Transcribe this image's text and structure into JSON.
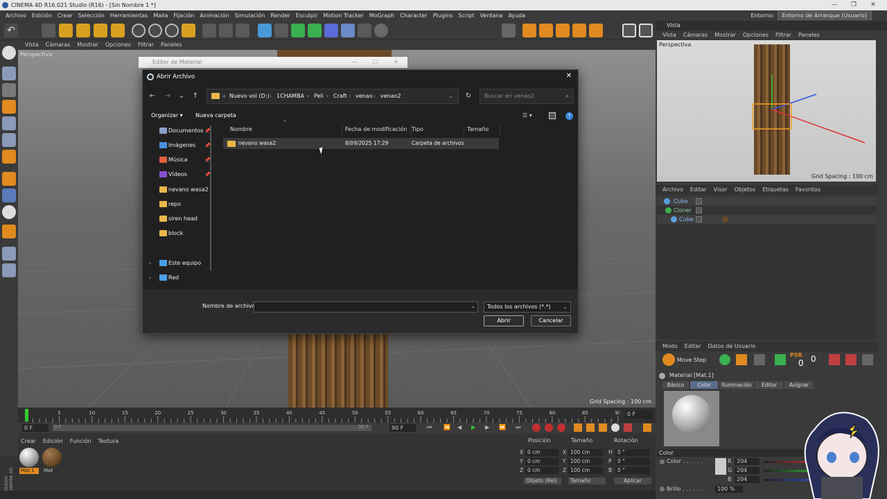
{
  "window": {
    "title": "CINEMA 4D R16.021 Studio (R16) - [Sin Nombre 1 *]",
    "controls": [
      "—",
      "❐",
      "✕"
    ]
  },
  "menubar": {
    "items": [
      "Archivo",
      "Edición",
      "Crear",
      "Selección",
      "Herramientas",
      "Malla",
      "Fijación",
      "Animación",
      "Simulación",
      "Render",
      "Esculpir",
      "Motion Tracker",
      "MoGraph",
      "Character",
      "Plugins",
      "Script",
      "Ventana",
      "Ayuda"
    ],
    "entorno_label": "Entorno:",
    "entorno_value": "Entorno de Arranque (Usuario)"
  },
  "viewport": {
    "menu": [
      "Vista",
      "Cámaras",
      "Mostrar",
      "Opciones",
      "Filtrar",
      "Paneles"
    ],
    "label": "Perspectiva",
    "grid_spacing": "Grid Spacing : 100 cm"
  },
  "right_view": {
    "header": "Vista",
    "menu": [
      "Vista",
      "Cámaras",
      "Mostrar",
      "Opciones",
      "Filtrar",
      "Paneles"
    ],
    "label": "Perspectiva",
    "grid_spacing": "Grid Spacing : 100 cm"
  },
  "object_manager": {
    "menu": [
      "Archivo",
      "Editar",
      "Visor",
      "Objetos",
      "Etiquetas",
      "Favoritos"
    ],
    "rows": [
      {
        "name": "Cube"
      },
      {
        "name": "Cloner"
      },
      {
        "name": "Cube"
      }
    ]
  },
  "attributes": {
    "menu": [
      "Modo",
      "Editar",
      "Datos de Usuario"
    ],
    "move_step": "Move Step",
    "psr": "PSR",
    "psr_val": "0",
    "l_val": "0",
    "material_name": "Material [Mat.1]",
    "tabs": [
      "Básico",
      "Color",
      "Iluminación",
      "Editor",
      "Asignar"
    ],
    "active_tab": "Color",
    "color_section": "Color",
    "color_label": "Color . . . . . .",
    "r_label": "R",
    "r_value": "204",
    "g_label": "G",
    "g_value": "204",
    "b_label": "B",
    "b_value": "204",
    "brillo_label": "Brillo . . . . . .",
    "brillo_value": "100 %"
  },
  "timeline": {
    "ticks": [
      "0",
      "5",
      "10",
      "15",
      "20",
      "25",
      "30",
      "35",
      "40",
      "45",
      "50",
      "55",
      "60",
      "65",
      "70",
      "75",
      "80",
      "85",
      "90"
    ],
    "end_frame": "0 F",
    "start_field": "0 F",
    "min_field": "0 F",
    "max_field": "90 F",
    "end_field": "90 F"
  },
  "material_manager": {
    "menu": [
      "Crear",
      "Edición",
      "Función",
      "Textura"
    ],
    "materials": [
      {
        "name": "Mat.1",
        "color": "#b0b0b0"
      },
      {
        "name": "Mat",
        "color": "#6b4a28"
      }
    ]
  },
  "coordinates": {
    "headers": [
      "Posición",
      "Tamaño",
      "Rotación"
    ],
    "rows": [
      {
        "axis": "X",
        "pos": "0 cm",
        "size_axis": "X",
        "size": "100 cm",
        "rot_axis": "H",
        "rot": "0 °"
      },
      {
        "axis": "Y",
        "pos": "0 cm",
        "size_axis": "Y",
        "size": "100 cm",
        "rot_axis": "P",
        "rot": "0 °"
      },
      {
        "axis": "Z",
        "pos": "0 cm",
        "size_axis": "Z",
        "size": "100 cm",
        "rot_axis": "B",
        "rot": "0 °"
      }
    ],
    "mode_select": "Objeto (Rel)",
    "size_select": "Tamaño",
    "apply": "Aplicar"
  },
  "maxon": "MAXON CINEMA 4D",
  "material_editor": {
    "title": "Editor de Material"
  },
  "dialog": {
    "title": "Abrir Archivo",
    "close": "✕",
    "nav": {
      "back": "←",
      "forward": "→",
      "recent": "⌄",
      "up": "↑"
    },
    "breadcrumb": [
      "Nuevo vol (D:)",
      "1CHAMBA",
      "Peli",
      "Craft",
      "venao",
      "venao2"
    ],
    "breadcrumb_prefix": "«",
    "search_placeholder": "Buscar en venao2",
    "commands": {
      "organize": "Organizar ▾",
      "new_folder": "Nueva carpeta"
    },
    "nav_items": [
      {
        "label": "Documentos",
        "pinned": true,
        "color": "#8aa0c8"
      },
      {
        "label": "Imágenes",
        "pinned": true,
        "color": "#4a90d9"
      },
      {
        "label": "Música",
        "pinned": true,
        "color": "#e06040"
      },
      {
        "label": "Vídeos",
        "pinned": true,
        "color": "#8a50d0"
      },
      {
        "label": "nevano wasa2",
        "pinned": false,
        "color": "#e8b84a"
      },
      {
        "label": "repo",
        "pinned": false,
        "color": "#e8b84a"
      },
      {
        "label": "siren head",
        "pinned": false,
        "color": "#e8b84a"
      },
      {
        "label": "block",
        "pinned": false,
        "color": "#e8b84a"
      },
      {
        "label": "Este equipo",
        "pinned": false,
        "color": "#4aa0e8",
        "expandable": true
      },
      {
        "label": "Red",
        "pinned": false,
        "color": "#4aa0e8",
        "expandable": true
      }
    ],
    "columns": [
      "Nombre",
      "Fecha de modificación",
      "Tipo",
      "Tamaño"
    ],
    "files": [
      {
        "name": "nevano wasa2",
        "modified": "8/09/2025 17:29",
        "type": "Carpeta de archivos",
        "size": ""
      }
    ],
    "filename_label": "Nombre de archivo:",
    "filename_value": "",
    "filetype": "Todos los archivos (*.*)",
    "open_button": "Abrir",
    "cancel_button": "Cancelar"
  }
}
